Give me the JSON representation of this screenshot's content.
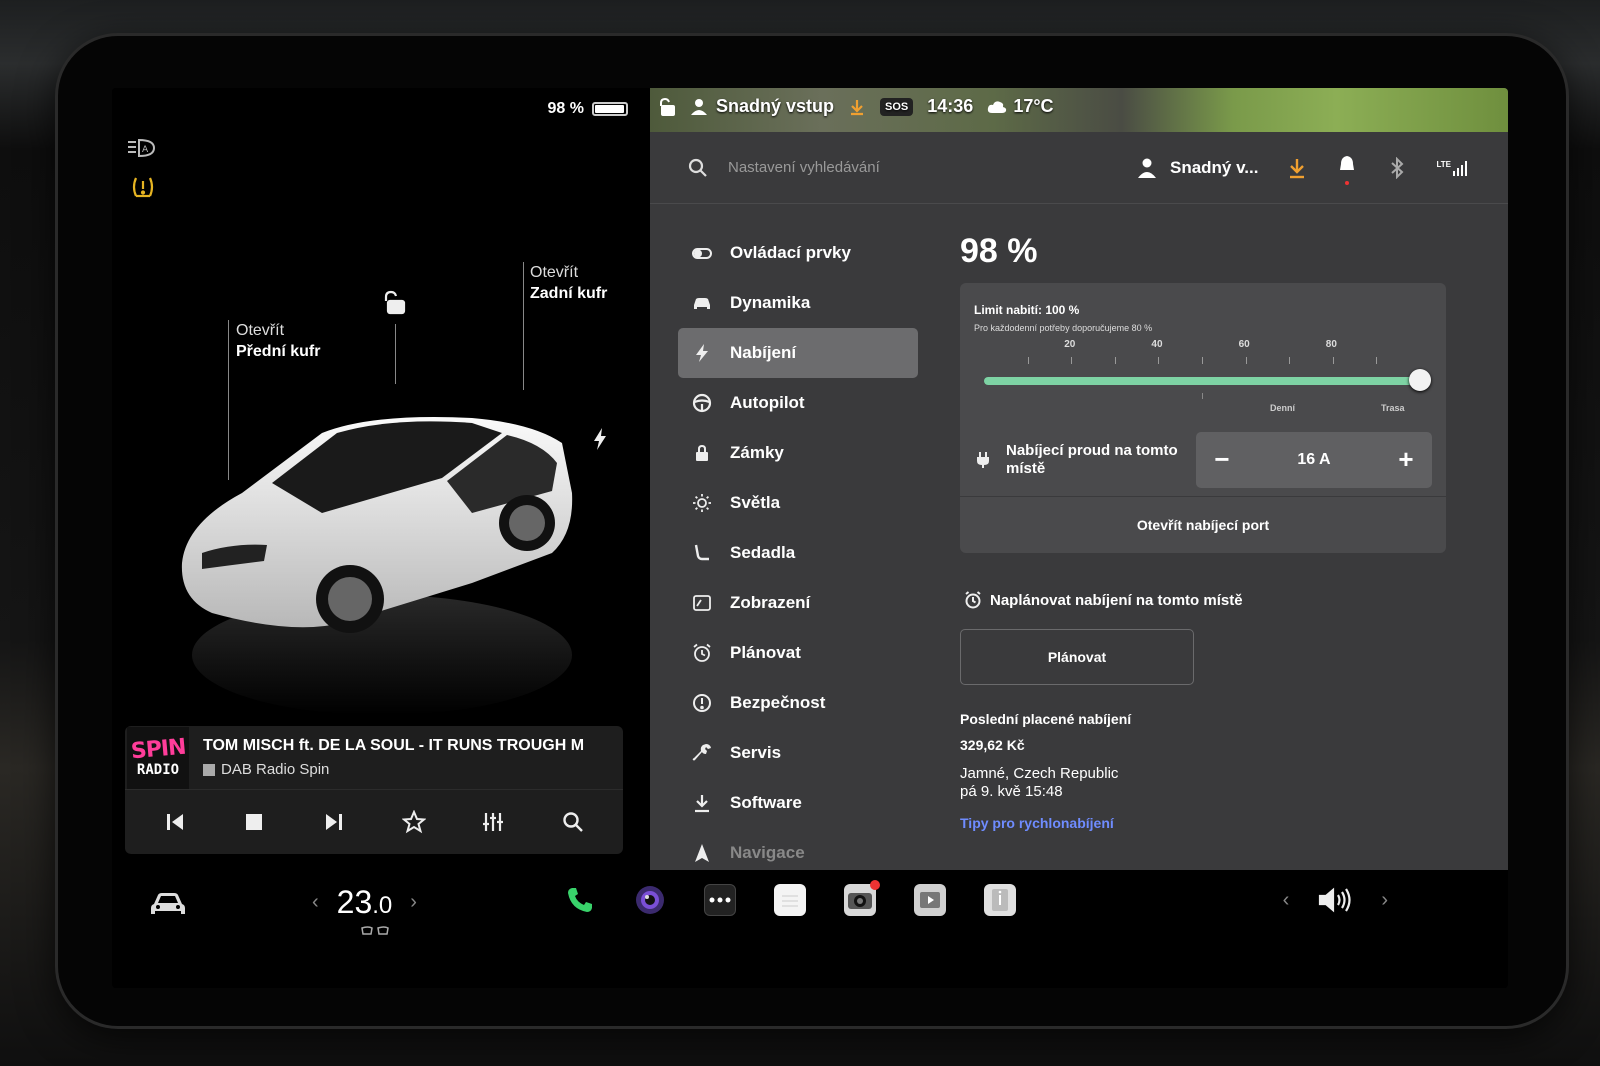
{
  "battery": {
    "percent_text": "98 %",
    "level": 0.98
  },
  "left_panel": {
    "front_trunk": {
      "action": "Otevřít",
      "name": "Přední kufr"
    },
    "rear_trunk": {
      "action": "Otevřít",
      "name": "Zadní kufr"
    }
  },
  "media": {
    "logo_line1": "SPIN",
    "logo_line2": "RADIO",
    "track_title": "TOM MISCH ft. DE LA SOUL - IT RUNS TROUGH M",
    "station": "DAB Radio Spin"
  },
  "statusbar": {
    "profile": "Snadný vstup",
    "sos": "SOS",
    "time": "14:36",
    "temperature": "17°C"
  },
  "topbar": {
    "search_placeholder": "Nastavení vyhledávání",
    "user": "Snadný v...",
    "lte": "LTE"
  },
  "nav": [
    {
      "label": "Ovládací prvky",
      "icon": "toggle-icon"
    },
    {
      "label": "Dynamika",
      "icon": "car-icon"
    },
    {
      "label": "Nabíjení",
      "icon": "bolt-icon",
      "active": true
    },
    {
      "label": "Autopilot",
      "icon": "steering-wheel-icon"
    },
    {
      "label": "Zámky",
      "icon": "lock-icon"
    },
    {
      "label": "Světla",
      "icon": "sun-icon"
    },
    {
      "label": "Sedadla",
      "icon": "seat-icon"
    },
    {
      "label": "Zobrazení",
      "icon": "display-icon"
    },
    {
      "label": "Plánovat",
      "icon": "alarm-clock-icon"
    },
    {
      "label": "Bezpečnost",
      "icon": "alert-circle-icon"
    },
    {
      "label": "Servis",
      "icon": "wrench-icon"
    },
    {
      "label": "Software",
      "icon": "download-icon"
    },
    {
      "label": "Navigace",
      "icon": "navigation-icon"
    }
  ],
  "charging": {
    "percent": "98 %",
    "limit_title": "Limit nabití: 100 %",
    "limit_hint": "Pro každodenní potřeby doporučujeme 80 %",
    "limit_value": 100,
    "scale_labels": [
      "20",
      "40",
      "60",
      "80"
    ],
    "zone_daily": "Denní",
    "zone_trip": "Trasa",
    "current_label": "Nabíjecí proud na tomto místě",
    "current_minus": "−",
    "current_value": "16 A",
    "current_plus": "+",
    "open_port": "Otevřít nabíjecí port",
    "schedule_label": "Naplánovat nabíjení na tomto místě",
    "schedule_button": "Plánovat",
    "last_paid_title": "Poslední placené nabíjení",
    "last_paid_amount": "329,62 Kč",
    "last_paid_place": "Jamné, Czech Republic",
    "last_paid_date": "pá 9. kvě 15:48",
    "tips_link": "Tipy pro rychlonabíjení"
  },
  "bottom": {
    "temp_value": "23",
    "temp_decimal": ".0",
    "temp_left": "‹",
    "temp_right": "›",
    "vol_left": "‹",
    "vol_right": "›",
    "apps": [
      "phone-icon",
      "camera-lens-icon",
      "more-icon",
      "notes-icon",
      "dashcam-icon",
      "theater-icon",
      "manual-icon"
    ]
  },
  "colors": {
    "accent_green": "#7ed3a4",
    "link_blue": "#6f8cff",
    "warning_yellow": "#e6b422",
    "download_orange": "#f0a030",
    "notification_red": "#ee3333"
  }
}
